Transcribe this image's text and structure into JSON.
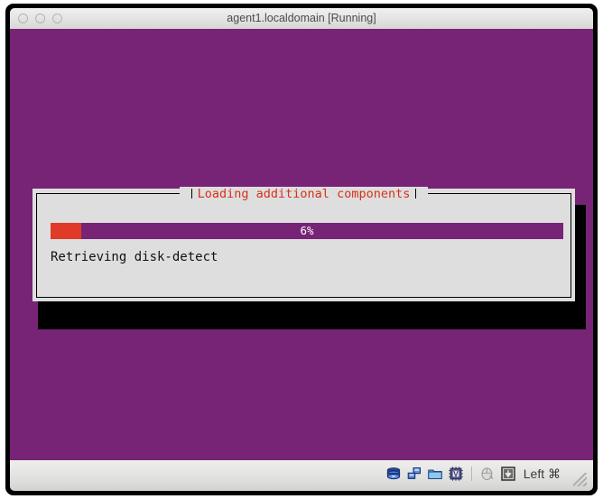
{
  "window": {
    "title": "agent1.localdomain [Running]",
    "traffic_lights": [
      "close",
      "minimize",
      "zoom"
    ]
  },
  "guest": {
    "background_color": "#772376",
    "dialog": {
      "title": "Loading additional components",
      "title_color": "#d63019",
      "background_color": "#dedede",
      "progress": {
        "percent_label": "6%",
        "percent_value": 6,
        "fill_color": "#e03a28",
        "track_color": "#772376",
        "label_color": "#ffffff"
      },
      "status_text": "Retrieving disk-detect"
    }
  },
  "statusbar": {
    "icons": [
      {
        "name": "hard-disk-icon",
        "title": "hard disks"
      },
      {
        "name": "network-icon",
        "title": "network adapters"
      },
      {
        "name": "shared-folders-icon",
        "title": "shared folders"
      },
      {
        "name": "cpu-chip-icon",
        "title": "virtualization",
        "glyph": "V"
      },
      {
        "name": "mouse-icon",
        "title": "mouse integration"
      },
      {
        "name": "host-key-icon",
        "title": "host key"
      }
    ],
    "host_key_label": "Left ⌘"
  }
}
